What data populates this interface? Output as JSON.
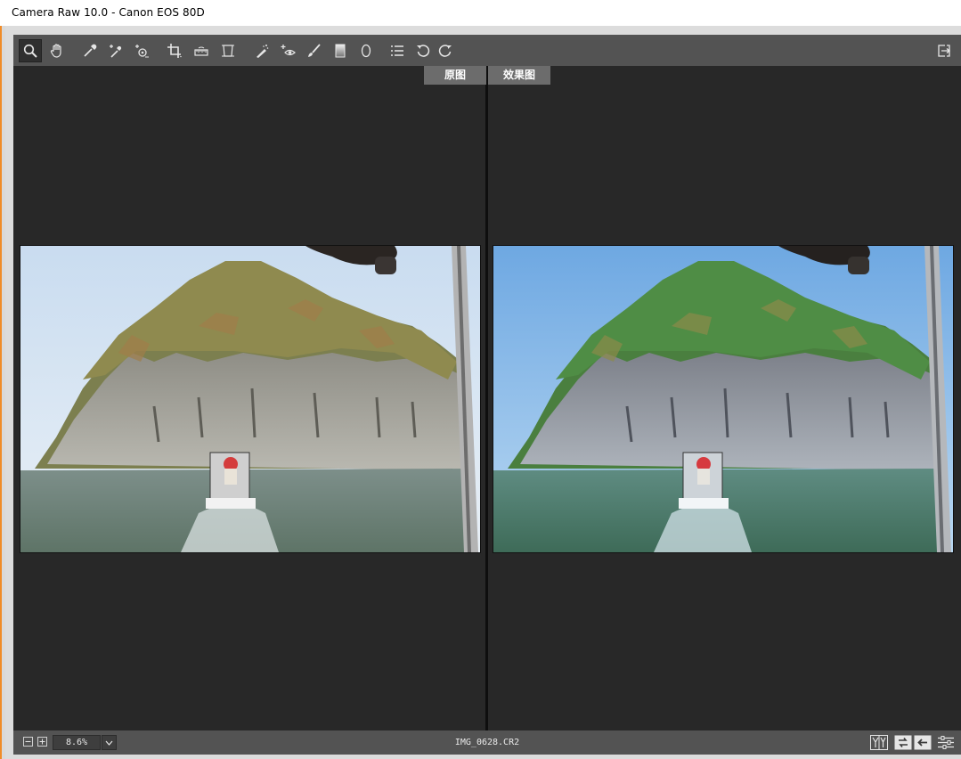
{
  "window": {
    "title": "Camera Raw 10.0 -  Canon EOS 80D"
  },
  "toolbar": {
    "tools": [
      {
        "name": "zoom-tool",
        "icon": "magnifier-icon",
        "active": true
      },
      {
        "name": "hand-tool",
        "icon": "hand-icon"
      },
      {
        "name": "white-balance-tool",
        "icon": "eyedropper-icon"
      },
      {
        "name": "color-sampler-tool",
        "icon": "color-sampler-icon"
      },
      {
        "name": "targeted-adjustment-tool",
        "icon": "target-adjust-icon"
      },
      {
        "name": "crop-tool",
        "icon": "crop-icon"
      },
      {
        "name": "straighten-tool",
        "icon": "straighten-icon"
      },
      {
        "name": "transform-tool",
        "icon": "transform-icon"
      },
      {
        "name": "spot-removal-tool",
        "icon": "spot-removal-icon"
      },
      {
        "name": "red-eye-tool",
        "icon": "red-eye-icon"
      },
      {
        "name": "adjustment-brush-tool",
        "icon": "brush-icon"
      },
      {
        "name": "graduated-filter-tool",
        "icon": "graduated-filter-icon"
      },
      {
        "name": "radial-filter-tool",
        "icon": "radial-filter-icon"
      },
      {
        "name": "preferences-button",
        "icon": "list-icon"
      },
      {
        "name": "rotate-left-button",
        "icon": "rotate-ccw-icon"
      },
      {
        "name": "rotate-right-button",
        "icon": "rotate-cw-icon"
      }
    ],
    "fullscreen_icon": "fullscreen-toggle-icon"
  },
  "viewer": {
    "before_label": "原图",
    "after_label": "效果图"
  },
  "statusbar": {
    "zoom_value": "8.6%",
    "filename": "IMG_0628.CR2",
    "right_icons": [
      "before-after-mode-icon",
      "swap-settings-icon",
      "copy-settings-icon",
      "toggle-settings-icon"
    ]
  },
  "colors": {
    "panel": "#535353",
    "canvas": "#282828",
    "label_bg": "#6c6c6c",
    "accent_orange": "#f08c28"
  }
}
